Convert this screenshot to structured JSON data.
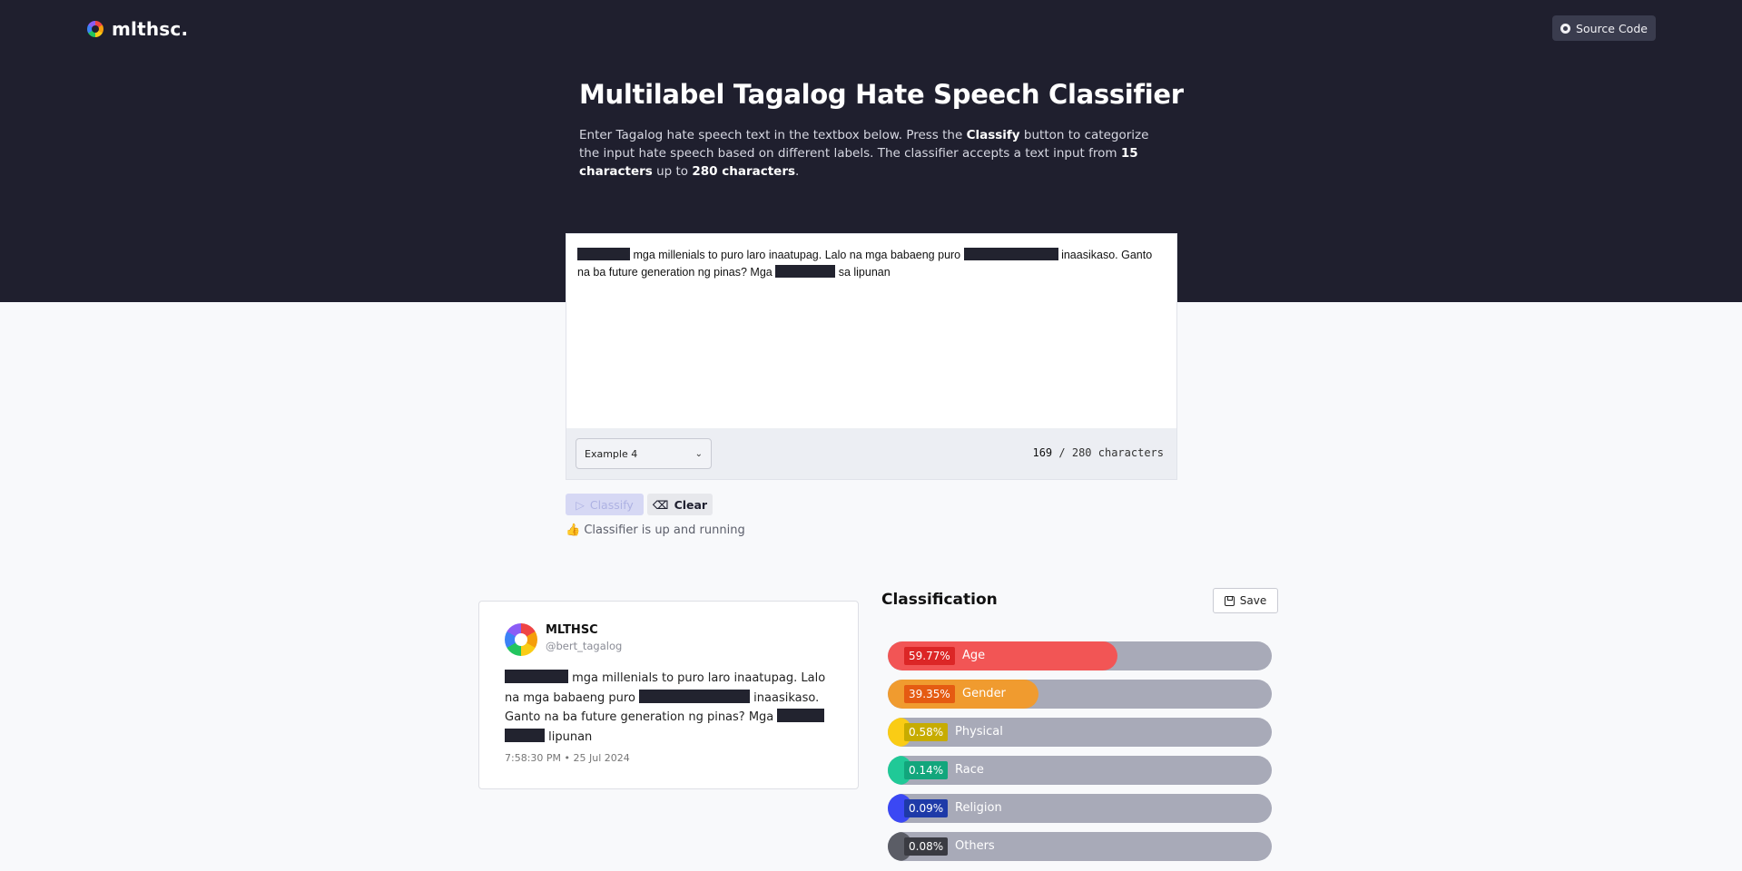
{
  "header": {
    "brand": "mlthsc.",
    "source_code_label": "Source Code"
  },
  "hero": {
    "title": "Multilabel Tagalog Hate Speech Classifier",
    "intro_1": "Enter Tagalog hate speech text in the textbox below. Press the ",
    "intro_bold_1": "Classify",
    "intro_2": " button to categorize the input hate speech based on different labels. The classifier accepts a text input from ",
    "intro_bold_2": "15 characters",
    "intro_3": " up to ",
    "intro_bold_3": "280 characters",
    "intro_4": "."
  },
  "editor": {
    "text_1": " mga millenials to puro laro inaatupag. Lalo na mga babaeng puro ",
    "text_2": " inaasikaso. Ganto na ba future generation ng pinas? Mga ",
    "text_3": " sa lipunan",
    "example_selected": "Example 4",
    "char_count": "169",
    "char_limit": "/ 280 characters"
  },
  "actions": {
    "classify_label": "Classify",
    "clear_label": "Clear",
    "status": "👍 Classifier is up and running"
  },
  "tweet": {
    "name": "MLTHSC",
    "handle": "@bert_tagalog",
    "text_1": " mga millenials to puro laro inaatupag. Lalo na mga babaeng puro ",
    "text_2": " inaasikaso. Ganto na ba future generation ng pinas? Mga ",
    "text_3": " lipunan",
    "time": "7:58:30 PM • 25 Jul 2024"
  },
  "classification": {
    "title": "Classification",
    "save_label": "Save",
    "labels": [
      {
        "label": "Age",
        "percent": "59.77%",
        "value": 59.77,
        "color": "#f25555",
        "badge": "#dc2626"
      },
      {
        "label": "Gender",
        "percent": "39.35%",
        "value": 39.35,
        "color": "#f09b2f",
        "badge": "#e55b12"
      },
      {
        "label": "Physical",
        "percent": "0.58%",
        "value": 0.58,
        "color": "#facc15",
        "badge": "#c7ac00"
      },
      {
        "label": "Race",
        "percent": "0.14%",
        "value": 0.14,
        "color": "#20c997",
        "badge": "#12a67c"
      },
      {
        "label": "Religion",
        "percent": "0.09%",
        "value": 0.09,
        "color": "#3b48f4",
        "badge": "#1e3aa8"
      },
      {
        "label": "Others",
        "percent": "0.08%",
        "value": 0.08,
        "color": "#5b5d66",
        "badge": "#3a3b42"
      }
    ]
  }
}
